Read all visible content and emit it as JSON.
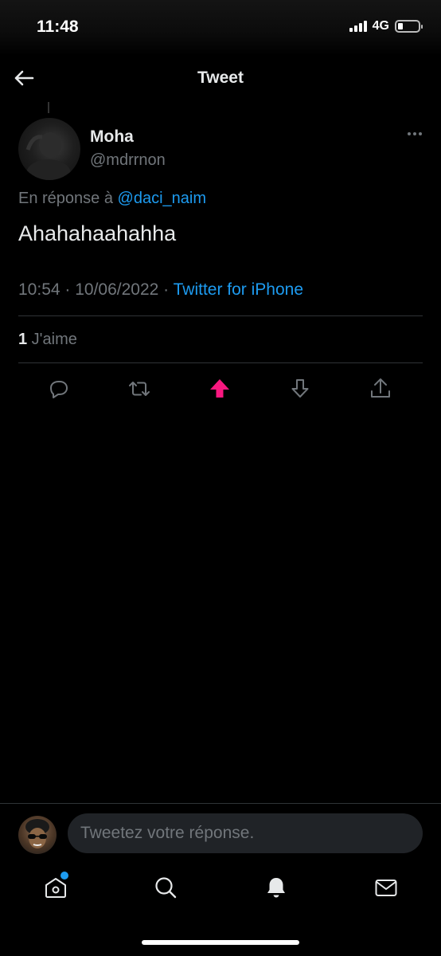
{
  "status_bar": {
    "time": "11:48",
    "network": "4G"
  },
  "header": {
    "title": "Tweet"
  },
  "tweet": {
    "author_name": "Moha",
    "author_handle": "@mdrrnon",
    "reply_prefix": "En réponse à ",
    "reply_mention": "@daci_naim",
    "text": "Ahahahaahahha",
    "timestamp": "10:54 · 10/06/2022 · ",
    "source": "Twitter for iPhone",
    "like_count": "1",
    "like_label": " J'aime"
  },
  "actions": [
    {
      "icon": "reply-icon"
    },
    {
      "icon": "retweet-icon"
    },
    {
      "icon": "upvote-icon",
      "active": true
    },
    {
      "icon": "downvote-icon"
    },
    {
      "icon": "share-icon"
    }
  ],
  "reply_composer": {
    "placeholder": "Tweetez votre réponse."
  },
  "tab_bar": {
    "items": [
      "home-icon",
      "search-icon",
      "notifications-icon",
      "messages-icon"
    ]
  },
  "colors": {
    "background": "#000000",
    "accent": "#1d9bf0",
    "upvote_active": "#f91880",
    "muted": "#71767b"
  }
}
